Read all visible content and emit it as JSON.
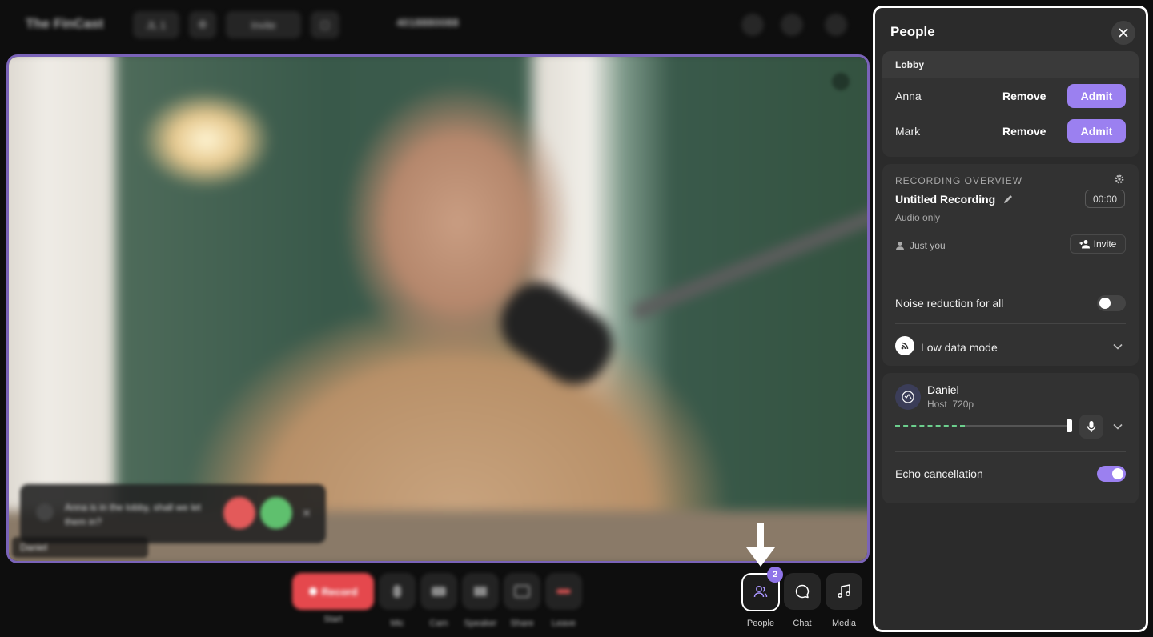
{
  "topbar": {
    "title": "The FinCast",
    "host_chip": "JL 1",
    "invite": "Invite",
    "phone": "4018880088"
  },
  "stage": {
    "toast_text": "Anna is in the lobby, shall we let them in?",
    "name_tag": "Daniel"
  },
  "controls": {
    "record": {
      "label": "Record",
      "caption": "Start"
    },
    "items": [
      {
        "label": "Mic",
        "icon": "mic-icon"
      },
      {
        "label": "Cam",
        "icon": "camera-icon"
      },
      {
        "label": "Speaker",
        "icon": "speaker-icon"
      },
      {
        "label": "Share",
        "icon": "share-icon"
      },
      {
        "label": "Leave",
        "icon": "hangup-icon"
      }
    ],
    "people": {
      "label": "People",
      "badge": "2",
      "icon": "people-icon"
    },
    "chat": {
      "label": "Chat",
      "icon": "chat-icon"
    },
    "media": {
      "label": "Media",
      "icon": "music-icon"
    }
  },
  "panel": {
    "title": "People",
    "lobby": {
      "heading": "Lobby",
      "guests": [
        {
          "name": "Anna",
          "remove": "Remove",
          "admit": "Admit"
        },
        {
          "name": "Mark",
          "remove": "Remove",
          "admit": "Admit"
        }
      ]
    },
    "recording": {
      "overview_label": "RECORDING OVERVIEW",
      "title": "Untitled Recording",
      "timer": "00:00",
      "mode": "Audio only",
      "participants": "Just you",
      "invite": "Invite"
    },
    "noise_reduction": {
      "label": "Noise reduction for all",
      "enabled": false
    },
    "low_data_mode": {
      "label": "Low data mode"
    },
    "participant": {
      "name": "Daniel",
      "role": "Host",
      "quality": "720p",
      "mic_level": 0.4,
      "volume": 1.0
    },
    "echo_cancellation": {
      "label": "Echo cancellation",
      "enabled": true
    }
  },
  "colors": {
    "accent": "#9b80f0",
    "record": "#e5484d",
    "level": "#6ccf8d"
  }
}
